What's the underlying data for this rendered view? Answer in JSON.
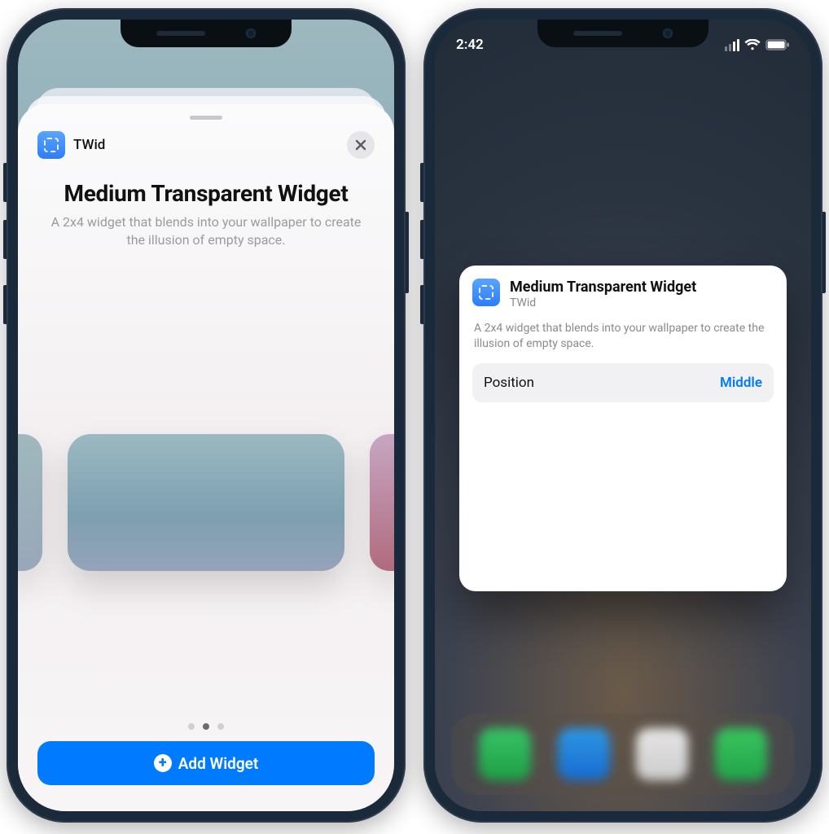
{
  "left": {
    "app_name": "TWid",
    "title": "Medium Transparent Widget",
    "description": "A 2x4 widget that blends into your wallpaper to create the illusion of empty space.",
    "add_button": "Add Widget",
    "page_index": 1,
    "page_count": 3
  },
  "right": {
    "status_time": "2:42",
    "card": {
      "title": "Medium Transparent Widget",
      "app_name": "TWid",
      "description": "A 2x4 widget that blends into your wallpaper to create the illusion of empty space.",
      "row_label": "Position",
      "row_value": "Middle"
    }
  }
}
